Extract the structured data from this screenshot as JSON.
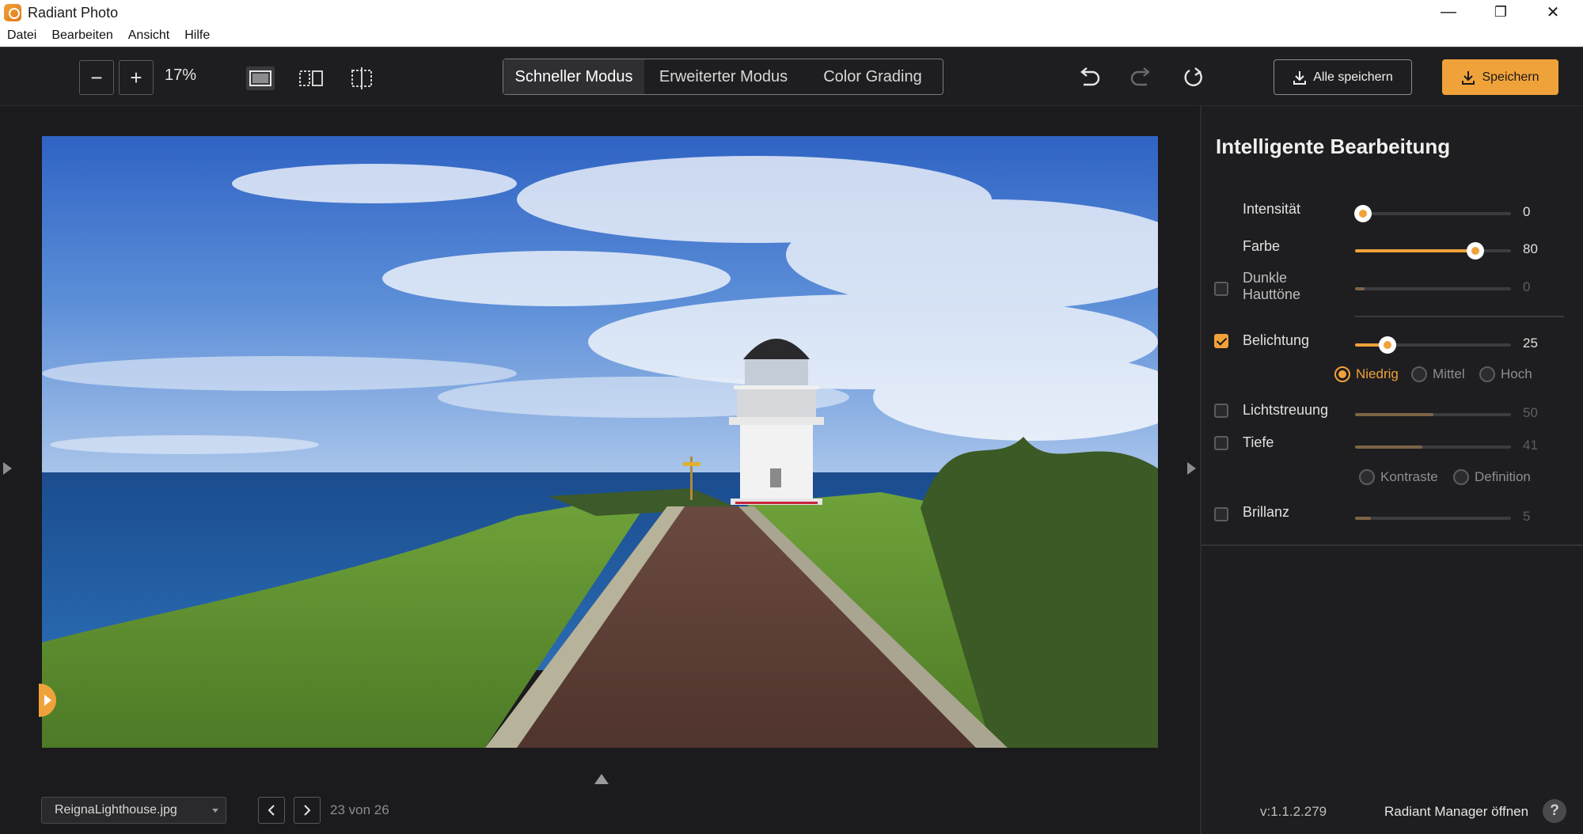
{
  "window": {
    "title": "Radiant Photo",
    "minimize": "—",
    "restore": "❐",
    "close": "✕"
  },
  "menu": [
    "Datei",
    "Bearbeiten",
    "Ansicht",
    "Hilfe"
  ],
  "toolbar": {
    "zoom_out": "−",
    "zoom_in": "+",
    "zoom_level": "17%",
    "view_icons": [
      "single-view-icon",
      "split-view-icon",
      "crop-view-icon"
    ],
    "modes": [
      "Schneller Modus",
      "Erweiterter Modus",
      "Color Grading"
    ],
    "active_mode": "Schneller Modus",
    "history_icons": [
      "undo-icon",
      "redo-icon",
      "reset-icon"
    ],
    "save_all_label": "Alle speichern",
    "save_label": "Speichern"
  },
  "canvas": {
    "photo_subject": "lighthouse-photo",
    "filename": "ReignaLighthouse.jpg",
    "page_count": "23 von 26"
  },
  "panel": {
    "title": "Intelligente Bearbeitung",
    "sliders": [
      {
        "label": "Intensität",
        "value": "0",
        "checkbox": false,
        "fraction": 0.05
      },
      {
        "label": "Farbe",
        "value": "80",
        "checkbox": false,
        "fraction": 0.77
      },
      {
        "label_line1": "Dunkle",
        "label_line2": "Hauttöne",
        "value": "0",
        "checkbox": "unchecked",
        "fraction": 0.06
      },
      {
        "label": "Belichtung",
        "value": "25",
        "checkbox": "checked",
        "fraction": 0.21
      },
      {
        "label": "Lichtstreuung",
        "value": "50",
        "checkbox": "unchecked",
        "fraction": 0.5
      },
      {
        "label": "Tiefe",
        "value": "41",
        "checkbox": "unchecked",
        "fraction": 0.43
      },
      {
        "label": "Brillanz",
        "value": "5",
        "checkbox": "unchecked",
        "fraction": 0.1
      }
    ],
    "exposure_options": [
      "Niedrig",
      "Mittel",
      "Hoch"
    ],
    "exposure_selected": "Niedrig",
    "depth_options": [
      "Kontraste",
      "Definition"
    ],
    "version": "v:1.1.2.279",
    "manager_label": "Radiant Manager öffnen",
    "help": "?"
  },
  "colors": {
    "accent": "#f0a23a",
    "background": "#1e1e20",
    "panel_text": "#e0e0e0"
  }
}
